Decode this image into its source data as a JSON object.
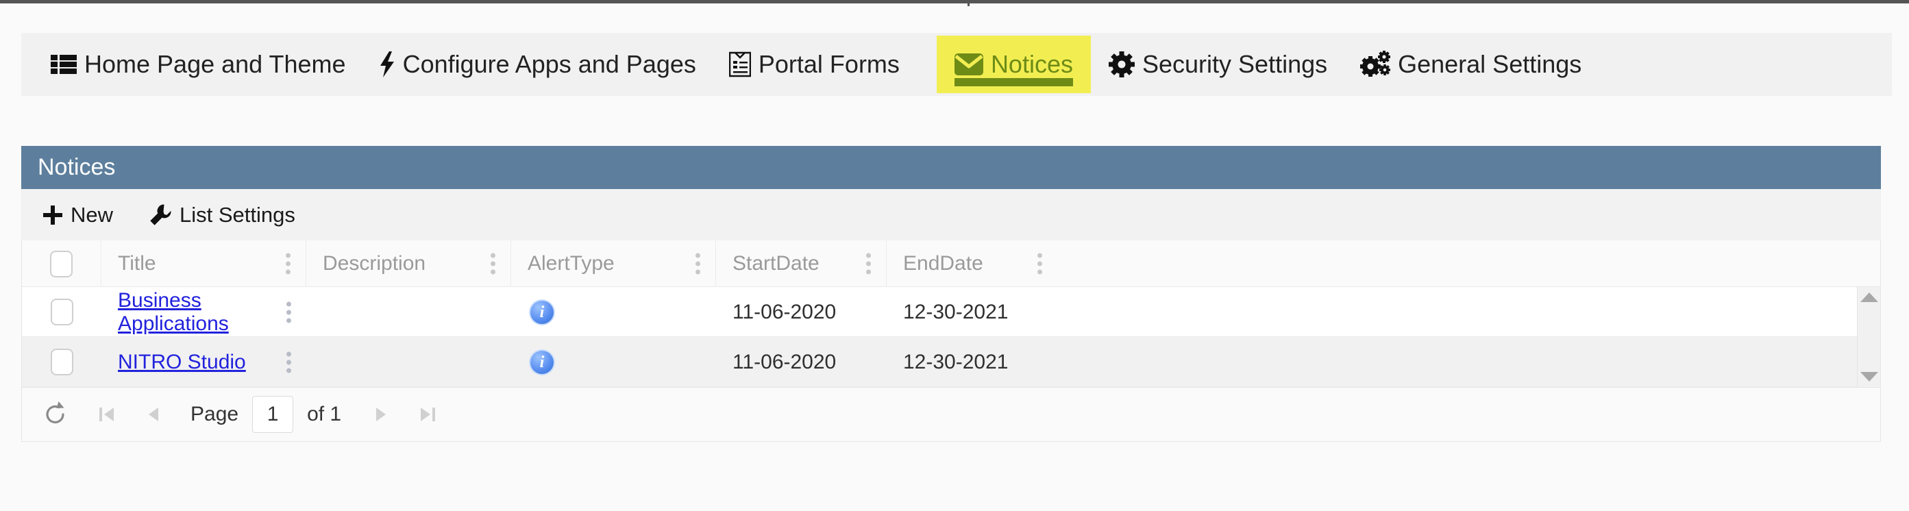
{
  "nav": {
    "items": [
      {
        "label": "Home Page and Theme",
        "icon": "list-grid-icon",
        "highlighted": false
      },
      {
        "label": "Configure Apps and Pages",
        "icon": "lightning-bolt-icon",
        "highlighted": false
      },
      {
        "label": "Portal Forms",
        "icon": "form-clipboard-icon",
        "highlighted": false
      },
      {
        "label": "Notices",
        "icon": "envelope-icon",
        "highlighted": true
      },
      {
        "label": "Security Settings",
        "icon": "gear-icon",
        "highlighted": false
      },
      {
        "label": "General Settings",
        "icon": "gears-icon",
        "highlighted": false
      }
    ]
  },
  "panel": {
    "title": "Notices",
    "header_color": "#5d7f9d",
    "highlight_color": "#f2ee52",
    "highlight_text_color": "#6e8b16"
  },
  "toolbar": {
    "new_label": "New",
    "new_icon": "plus-icon",
    "list_settings_label": "List Settings",
    "list_settings_icon": "wrench-icon"
  },
  "grid": {
    "columns": [
      {
        "key": "checkbox",
        "label": ""
      },
      {
        "key": "title",
        "label": "Title"
      },
      {
        "key": "description",
        "label": "Description"
      },
      {
        "key": "alerttype",
        "label": "AlertType"
      },
      {
        "key": "startdate",
        "label": "StartDate"
      },
      {
        "key": "enddate",
        "label": "EndDate"
      }
    ],
    "rows": [
      {
        "title": "Business Applications",
        "description": "",
        "alerttype": "info-icon",
        "startdate": "11-06-2020",
        "enddate": "12-30-2021"
      },
      {
        "title": "NITRO Studio",
        "description": "",
        "alerttype": "info-icon",
        "startdate": "11-06-2020",
        "enddate": "12-30-2021"
      }
    ]
  },
  "pager": {
    "refresh_icon": "refresh-icon",
    "first_icon": "first-page-icon",
    "prev_icon": "previous-page-icon",
    "page_label": "Page",
    "page_value": "1",
    "of_label": "of 1",
    "next_icon": "next-page-icon",
    "last_icon": "last-page-icon"
  }
}
